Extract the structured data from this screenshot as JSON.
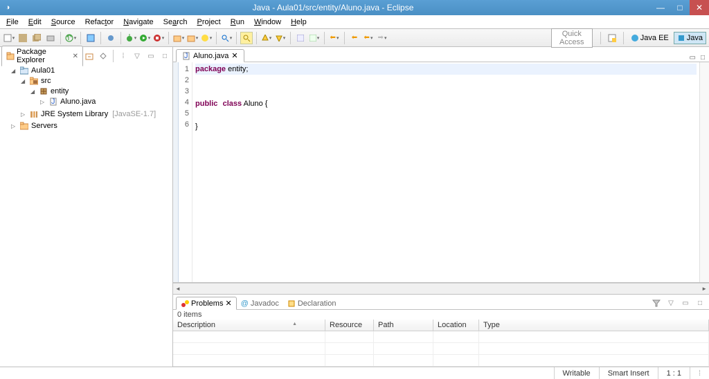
{
  "titlebar": {
    "text": "Java - Aula01/src/entity/Aluno.java - Eclipse"
  },
  "menu": [
    "File",
    "Edit",
    "Source",
    "Refactor",
    "Navigate",
    "Search",
    "Project",
    "Run",
    "Window",
    "Help"
  ],
  "quick_access": "Quick Access",
  "perspectives": {
    "javaee": "Java EE",
    "java": "Java"
  },
  "package_explorer": {
    "title": "Package Explorer",
    "project": "Aula01",
    "src": "src",
    "pkg": "entity",
    "file": "Aluno.java",
    "jre": "JRE System Library",
    "jre_suffix": "[JavaSE-1.7]",
    "servers": "Servers"
  },
  "editor": {
    "tab": "Aluno.java",
    "lines": [
      "1",
      "2",
      "3",
      "4",
      "5",
      "6"
    ],
    "code": {
      "l1_kw": "package",
      "l1_rest": " entity;",
      "l3_kw1": "public",
      "l3_kw2": "class",
      "l3_rest": " Aluno {",
      "l5": "}"
    }
  },
  "bottom": {
    "tabs": {
      "problems": "Problems",
      "javadoc": "Javadoc",
      "declaration": "Declaration"
    },
    "count": "0 items",
    "headers": {
      "description": "Description",
      "resource": "Resource",
      "path": "Path",
      "location": "Location",
      "type": "Type"
    }
  },
  "status": {
    "writable": "Writable",
    "insert": "Smart Insert",
    "pos": "1 : 1"
  }
}
